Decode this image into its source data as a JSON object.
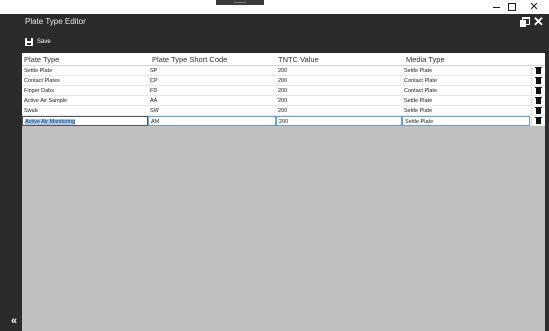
{
  "window": {
    "close_glyph": "✕"
  },
  "page": {
    "title": "Plate Type Editor"
  },
  "header_icons": {
    "restore": "restore-icon",
    "close": "✕"
  },
  "toolbar": {
    "save_label": "Save"
  },
  "sidebar": {
    "collapse_glyph": "«"
  },
  "table": {
    "columns": [
      "Plate Type",
      "Plate Type Short Code",
      "TNTC Value",
      "Media Type"
    ],
    "rows": [
      {
        "plate_type": "Settle Plate",
        "short_code": "SP",
        "tntc": "200",
        "media_type": "Settle Plate"
      },
      {
        "plate_type": "Contact Plates",
        "short_code": "CP",
        "tntc": "200",
        "media_type": "Contact Plate"
      },
      {
        "plate_type": "Finger Dabs",
        "short_code": "FD",
        "tntc": "200",
        "media_type": "Contact Plate"
      },
      {
        "plate_type": "Active Air Sample",
        "short_code": "AA",
        "tntc": "200",
        "media_type": "Settle Plate"
      },
      {
        "plate_type": "Swab",
        "short_code": "SW",
        "tntc": "200",
        "media_type": "Settle Plate"
      },
      {
        "plate_type": "Active Air Monitoring",
        "short_code": "AM",
        "tntc": "200",
        "media_type": "Settle Plate"
      }
    ]
  },
  "colors": {
    "background": "#2b2b2b",
    "grid_empty": "#c0c0c0",
    "selection": "#a8c8f0"
  }
}
